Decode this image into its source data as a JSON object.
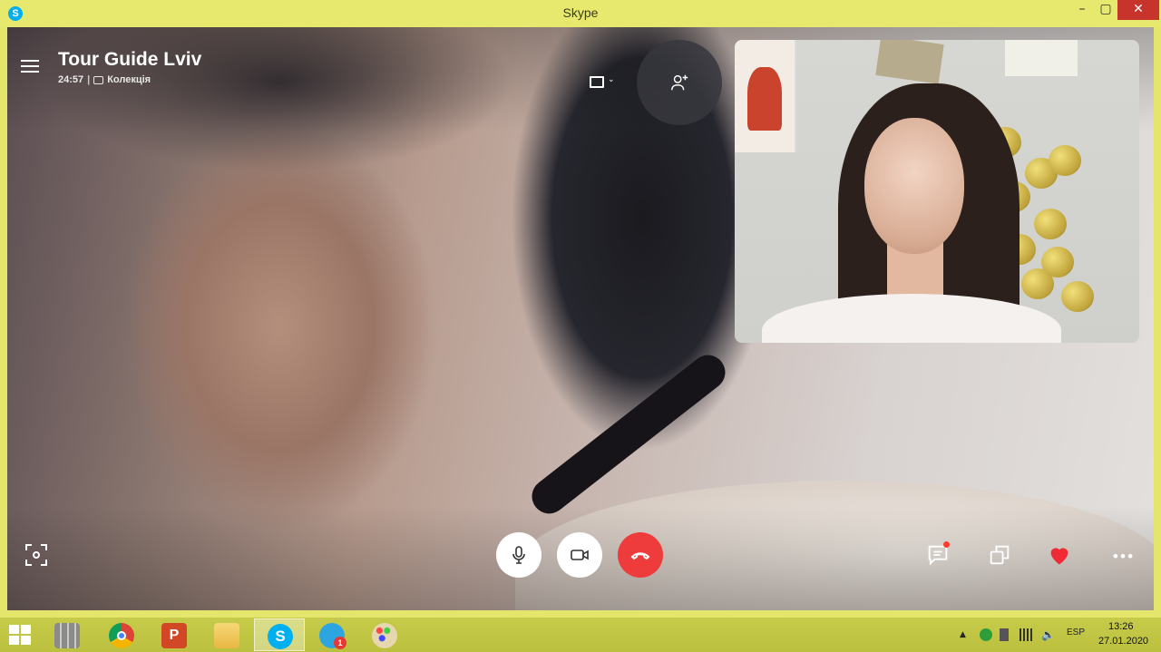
{
  "window": {
    "title": "Skype",
    "app_icon_letter": "S",
    "minimize_label": "–",
    "maximize_label": "▢",
    "close_label": "✕"
  },
  "call": {
    "contact_name": "Tour Guide Lviv",
    "duration": "24:57",
    "separator": "|",
    "collection_label": "Колекція"
  },
  "taskbar": {
    "apps": [
      "windows-explorer-grid",
      "chrome",
      "powerpoint",
      "file-explorer",
      "skype",
      "telegram",
      "paint"
    ],
    "telegram_badge": "1",
    "keyboard_layout": "ESP",
    "time": "13:26",
    "date": "27.01.2020"
  },
  "colors": {
    "hangup_red": "#ee3b3b",
    "heart_red": "#ef2b36",
    "skype_blue": "#00aff0",
    "taskbar_yellow": "#c7cb4a"
  }
}
